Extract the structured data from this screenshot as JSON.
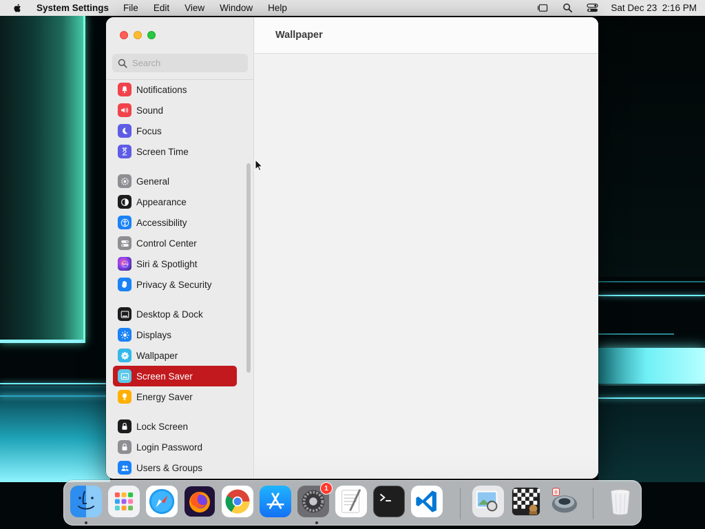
{
  "menubar": {
    "app_name": "System Settings",
    "menus": [
      "File",
      "Edit",
      "View",
      "Window",
      "Help"
    ],
    "clock": "Sat Dec 23  2:16 PM"
  },
  "window": {
    "title": "Wallpaper",
    "search_placeholder": "Search"
  },
  "sidebar": {
    "items": [
      {
        "label": "Notifications",
        "icon": "notifications-icon",
        "color": "#f0434b"
      },
      {
        "label": "Sound",
        "icon": "sound-icon",
        "color": "#f0434b"
      },
      {
        "label": "Focus",
        "icon": "focus-icon",
        "color": "#5e5ce6"
      },
      {
        "label": "Screen Time",
        "icon": "screen-time-icon",
        "color": "#5e5ce6"
      },
      {
        "label": "General",
        "icon": "general-icon",
        "color": "#8e8e93"
      },
      {
        "label": "Appearance",
        "icon": "appearance-icon",
        "color": "#1c1c1e"
      },
      {
        "label": "Accessibility",
        "icon": "accessibility-icon",
        "color": "#1a82f6"
      },
      {
        "label": "Control Center",
        "icon": "control-center-icon",
        "color": "#8e8e93"
      },
      {
        "label": "Siri & Spotlight",
        "icon": "siri-icon",
        "color": "#b04ad8"
      },
      {
        "label": "Privacy & Security",
        "icon": "privacy-icon",
        "color": "#1a82f6"
      },
      {
        "label": "Desktop & Dock",
        "icon": "desktop-dock-icon",
        "color": "#1c1c1e"
      },
      {
        "label": "Displays",
        "icon": "displays-icon",
        "color": "#1a82f6"
      },
      {
        "label": "Wallpaper",
        "icon": "wallpaper-icon",
        "color": "#35b8e8"
      },
      {
        "label": "Screen Saver",
        "icon": "screen-saver-icon",
        "color": "#5bc8e8",
        "selected": true
      },
      {
        "label": "Energy Saver",
        "icon": "energy-saver-icon",
        "color": "#ffb000"
      },
      {
        "label": "Lock Screen",
        "icon": "lock-screen-icon",
        "color": "#1c1c1e"
      },
      {
        "label": "Login Password",
        "icon": "login-password-icon",
        "color": "#8e8e93"
      },
      {
        "label": "Users & Groups",
        "icon": "users-groups-icon",
        "color": "#1a82f6"
      }
    ],
    "selected_color": "#c1191e"
  },
  "dock": {
    "apps": [
      {
        "name": "Finder",
        "icon": "finder-icon",
        "running": true
      },
      {
        "name": "Launchpad",
        "icon": "launchpad-icon"
      },
      {
        "name": "Safari",
        "icon": "safari-icon"
      },
      {
        "name": "Firefox",
        "icon": "firefox-icon"
      },
      {
        "name": "Chrome",
        "icon": "chrome-icon"
      },
      {
        "name": "App Store",
        "icon": "app-store-icon"
      },
      {
        "name": "System Settings",
        "icon": "system-settings-icon",
        "running": true,
        "badge": "1"
      },
      {
        "name": "TextEdit",
        "icon": "textedit-icon"
      },
      {
        "name": "Terminal",
        "icon": "terminal-icon"
      },
      {
        "name": "VS Code",
        "icon": "vscode-icon"
      },
      {
        "name": "Preview",
        "icon": "preview-icon"
      },
      {
        "name": "Chess",
        "icon": "chess-icon"
      },
      {
        "name": "Automator",
        "icon": "automator-icon"
      },
      {
        "name": "Trash",
        "icon": "trash-icon"
      }
    ]
  }
}
